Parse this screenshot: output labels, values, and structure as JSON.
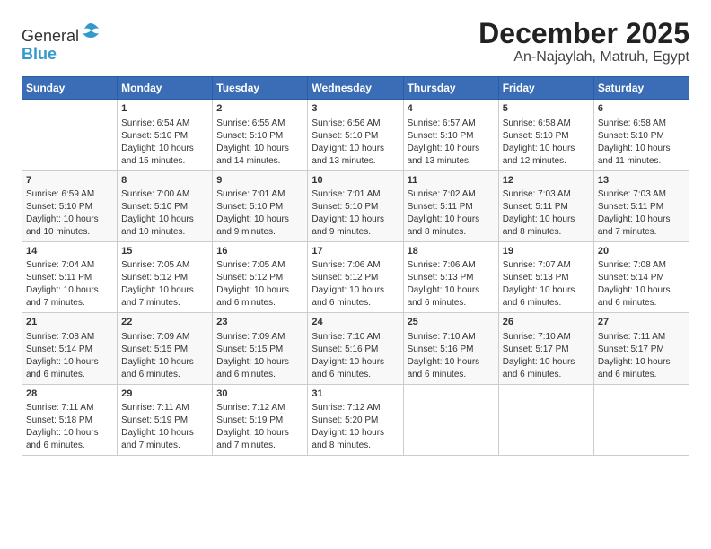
{
  "logo": {
    "general": "General",
    "blue": "Blue"
  },
  "title": "December 2025",
  "subtitle": "An-Najaylah, Matruh, Egypt",
  "headers": [
    "Sunday",
    "Monday",
    "Tuesday",
    "Wednesday",
    "Thursday",
    "Friday",
    "Saturday"
  ],
  "rows": [
    [
      {
        "day": "",
        "lines": []
      },
      {
        "day": "1",
        "lines": [
          "Sunrise: 6:54 AM",
          "Sunset: 5:10 PM",
          "Daylight: 10 hours",
          "and 15 minutes."
        ]
      },
      {
        "day": "2",
        "lines": [
          "Sunrise: 6:55 AM",
          "Sunset: 5:10 PM",
          "Daylight: 10 hours",
          "and 14 minutes."
        ]
      },
      {
        "day": "3",
        "lines": [
          "Sunrise: 6:56 AM",
          "Sunset: 5:10 PM",
          "Daylight: 10 hours",
          "and 13 minutes."
        ]
      },
      {
        "day": "4",
        "lines": [
          "Sunrise: 6:57 AM",
          "Sunset: 5:10 PM",
          "Daylight: 10 hours",
          "and 13 minutes."
        ]
      },
      {
        "day": "5",
        "lines": [
          "Sunrise: 6:58 AM",
          "Sunset: 5:10 PM",
          "Daylight: 10 hours",
          "and 12 minutes."
        ]
      },
      {
        "day": "6",
        "lines": [
          "Sunrise: 6:58 AM",
          "Sunset: 5:10 PM",
          "Daylight: 10 hours",
          "and 11 minutes."
        ]
      }
    ],
    [
      {
        "day": "7",
        "lines": [
          "Sunrise: 6:59 AM",
          "Sunset: 5:10 PM",
          "Daylight: 10 hours",
          "and 10 minutes."
        ]
      },
      {
        "day": "8",
        "lines": [
          "Sunrise: 7:00 AM",
          "Sunset: 5:10 PM",
          "Daylight: 10 hours",
          "and 10 minutes."
        ]
      },
      {
        "day": "9",
        "lines": [
          "Sunrise: 7:01 AM",
          "Sunset: 5:10 PM",
          "Daylight: 10 hours",
          "and 9 minutes."
        ]
      },
      {
        "day": "10",
        "lines": [
          "Sunrise: 7:01 AM",
          "Sunset: 5:10 PM",
          "Daylight: 10 hours",
          "and 9 minutes."
        ]
      },
      {
        "day": "11",
        "lines": [
          "Sunrise: 7:02 AM",
          "Sunset: 5:11 PM",
          "Daylight: 10 hours",
          "and 8 minutes."
        ]
      },
      {
        "day": "12",
        "lines": [
          "Sunrise: 7:03 AM",
          "Sunset: 5:11 PM",
          "Daylight: 10 hours",
          "and 8 minutes."
        ]
      },
      {
        "day": "13",
        "lines": [
          "Sunrise: 7:03 AM",
          "Sunset: 5:11 PM",
          "Daylight: 10 hours",
          "and 7 minutes."
        ]
      }
    ],
    [
      {
        "day": "14",
        "lines": [
          "Sunrise: 7:04 AM",
          "Sunset: 5:11 PM",
          "Daylight: 10 hours",
          "and 7 minutes."
        ]
      },
      {
        "day": "15",
        "lines": [
          "Sunrise: 7:05 AM",
          "Sunset: 5:12 PM",
          "Daylight: 10 hours",
          "and 7 minutes."
        ]
      },
      {
        "day": "16",
        "lines": [
          "Sunrise: 7:05 AM",
          "Sunset: 5:12 PM",
          "Daylight: 10 hours",
          "and 6 minutes."
        ]
      },
      {
        "day": "17",
        "lines": [
          "Sunrise: 7:06 AM",
          "Sunset: 5:12 PM",
          "Daylight: 10 hours",
          "and 6 minutes."
        ]
      },
      {
        "day": "18",
        "lines": [
          "Sunrise: 7:06 AM",
          "Sunset: 5:13 PM",
          "Daylight: 10 hours",
          "and 6 minutes."
        ]
      },
      {
        "day": "19",
        "lines": [
          "Sunrise: 7:07 AM",
          "Sunset: 5:13 PM",
          "Daylight: 10 hours",
          "and 6 minutes."
        ]
      },
      {
        "day": "20",
        "lines": [
          "Sunrise: 7:08 AM",
          "Sunset: 5:14 PM",
          "Daylight: 10 hours",
          "and 6 minutes."
        ]
      }
    ],
    [
      {
        "day": "21",
        "lines": [
          "Sunrise: 7:08 AM",
          "Sunset: 5:14 PM",
          "Daylight: 10 hours",
          "and 6 minutes."
        ]
      },
      {
        "day": "22",
        "lines": [
          "Sunrise: 7:09 AM",
          "Sunset: 5:15 PM",
          "Daylight: 10 hours",
          "and 6 minutes."
        ]
      },
      {
        "day": "23",
        "lines": [
          "Sunrise: 7:09 AM",
          "Sunset: 5:15 PM",
          "Daylight: 10 hours",
          "and 6 minutes."
        ]
      },
      {
        "day": "24",
        "lines": [
          "Sunrise: 7:10 AM",
          "Sunset: 5:16 PM",
          "Daylight: 10 hours",
          "and 6 minutes."
        ]
      },
      {
        "day": "25",
        "lines": [
          "Sunrise: 7:10 AM",
          "Sunset: 5:16 PM",
          "Daylight: 10 hours",
          "and 6 minutes."
        ]
      },
      {
        "day": "26",
        "lines": [
          "Sunrise: 7:10 AM",
          "Sunset: 5:17 PM",
          "Daylight: 10 hours",
          "and 6 minutes."
        ]
      },
      {
        "day": "27",
        "lines": [
          "Sunrise: 7:11 AM",
          "Sunset: 5:17 PM",
          "Daylight: 10 hours",
          "and 6 minutes."
        ]
      }
    ],
    [
      {
        "day": "28",
        "lines": [
          "Sunrise: 7:11 AM",
          "Sunset: 5:18 PM",
          "Daylight: 10 hours",
          "and 6 minutes."
        ]
      },
      {
        "day": "29",
        "lines": [
          "Sunrise: 7:11 AM",
          "Sunset: 5:19 PM",
          "Daylight: 10 hours",
          "and 7 minutes."
        ]
      },
      {
        "day": "30",
        "lines": [
          "Sunrise: 7:12 AM",
          "Sunset: 5:19 PM",
          "Daylight: 10 hours",
          "and 7 minutes."
        ]
      },
      {
        "day": "31",
        "lines": [
          "Sunrise: 7:12 AM",
          "Sunset: 5:20 PM",
          "Daylight: 10 hours",
          "and 8 minutes."
        ]
      },
      {
        "day": "",
        "lines": []
      },
      {
        "day": "",
        "lines": []
      },
      {
        "day": "",
        "lines": []
      }
    ]
  ]
}
